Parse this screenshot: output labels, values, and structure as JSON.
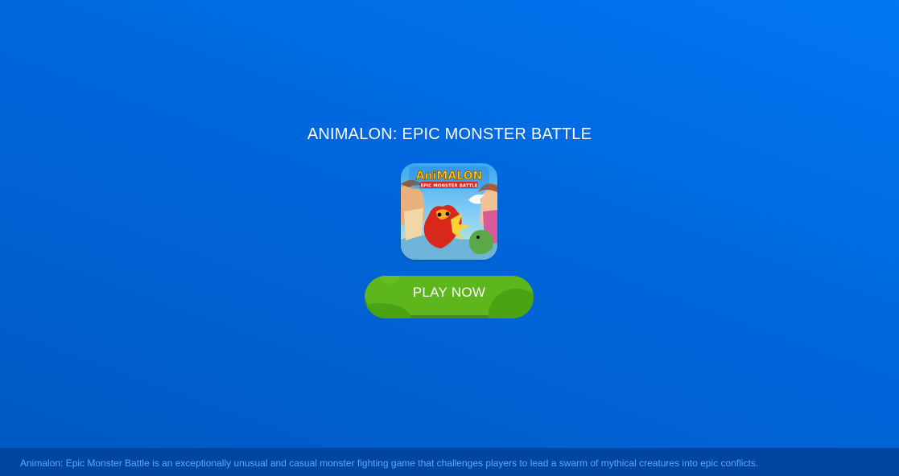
{
  "game": {
    "title": "ANIMALON: EPIC MONSTER BATTLE",
    "thumbnail_logo": "AniMALON",
    "thumbnail_subtitle": "EPIC MONSTER BATTLE"
  },
  "play_button": {
    "label": "PLAY NOW"
  },
  "footer": {
    "description": "Animalon: Epic Monster Battle is an exceptionally unusual and casual monster fighting game that challenges players to lead a swarm of mythical creatures into epic conflicts."
  },
  "colors": {
    "background_top": "#0177f2",
    "background_bottom": "#0058c0",
    "button_green": "#5cb61c",
    "footer_bar": "#0046a0",
    "footer_text": "#56a8ff"
  }
}
